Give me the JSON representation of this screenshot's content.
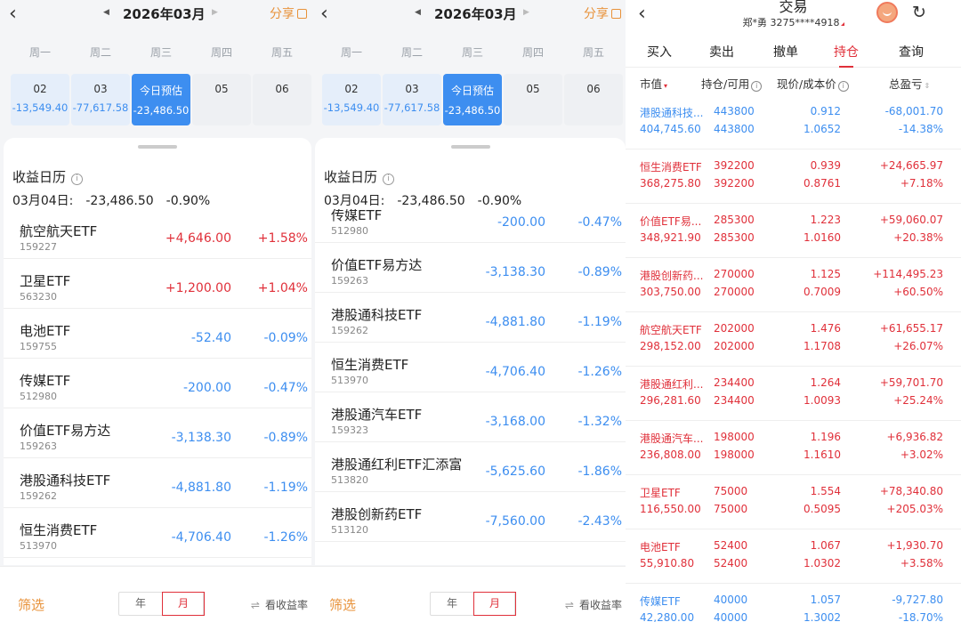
{
  "calendar": {
    "back_icon": "chevron-left-icon",
    "month": "2026年03月",
    "share_label": "分享",
    "weekdays": [
      "周一",
      "周二",
      "周三",
      "周四",
      "周五"
    ],
    "days": [
      {
        "day": "02",
        "value": "-13,549.40"
      },
      {
        "day": "03",
        "value": "-77,617.58"
      },
      {
        "day": "今日预估",
        "value": "-23,486.50"
      },
      {
        "day": "05",
        "value": ""
      },
      {
        "day": "06",
        "value": ""
      }
    ],
    "section_title": "收益日历",
    "summary": {
      "date": "03月04日:",
      "amount": "-23,486.50",
      "percent": "-0.90%"
    },
    "filter_label": "筛选",
    "seg_year": "年",
    "seg_month": "月",
    "yield_label": "看收益率"
  },
  "list_left": [
    {
      "name": "航空航天ETF",
      "code": "159227",
      "amount": "+4,646.00",
      "percent": "+1.58%",
      "up": true
    },
    {
      "name": "卫星ETF",
      "code": "563230",
      "amount": "+1,200.00",
      "percent": "+1.04%",
      "up": true
    },
    {
      "name": "电池ETF",
      "code": "159755",
      "amount": "-52.40",
      "percent": "-0.09%",
      "up": false
    },
    {
      "name": "传媒ETF",
      "code": "512980",
      "amount": "-200.00",
      "percent": "-0.47%",
      "up": false
    },
    {
      "name": "价值ETF易方达",
      "code": "159263",
      "amount": "-3,138.30",
      "percent": "-0.89%",
      "up": false
    },
    {
      "name": "港股通科技ETF",
      "code": "159262",
      "amount": "-4,881.80",
      "percent": "-1.19%",
      "up": false
    },
    {
      "name": "恒生消费ETF",
      "code": "513970",
      "amount": "-4,706.40",
      "percent": "-1.26%",
      "up": false
    }
  ],
  "list_right": [
    {
      "name": "传媒ETF",
      "code": "512980",
      "amount": "-200.00",
      "percent": "-0.47%",
      "up": false
    },
    {
      "name": "价值ETF易方达",
      "code": "159263",
      "amount": "-3,138.30",
      "percent": "-0.89%",
      "up": false
    },
    {
      "name": "港股通科技ETF",
      "code": "159262",
      "amount": "-4,881.80",
      "percent": "-1.19%",
      "up": false
    },
    {
      "name": "恒生消费ETF",
      "code": "513970",
      "amount": "-4,706.40",
      "percent": "-1.26%",
      "up": false
    },
    {
      "name": "港股通汽车ETF",
      "code": "159323",
      "amount": "-3,168.00",
      "percent": "-1.32%",
      "up": false
    },
    {
      "name": "港股通红利ETF汇添富",
      "code": "513820",
      "amount": "-5,625.60",
      "percent": "-1.86%",
      "up": false
    },
    {
      "name": "港股创新药ETF",
      "code": "513120",
      "amount": "-7,560.00",
      "percent": "-2.43%",
      "up": false
    }
  ],
  "trade": {
    "title": "交易",
    "account": "郑*勇 3275****4918",
    "tabs": [
      "买入",
      "卖出",
      "撤单",
      "持仓",
      "查询"
    ],
    "active_tab": 3,
    "columns": [
      "市值",
      "持仓/可用",
      "现价/成本价",
      "总盈亏"
    ],
    "holdings": [
      {
        "name": "港股通科技...",
        "value": "404,745.60",
        "hold": "443800",
        "avail": "443800",
        "price": "0.912",
        "cost": "1.0652",
        "pnl": "-68,001.70",
        "pnl_pct": "-14.38%",
        "up": false
      },
      {
        "name": "恒生消费ETF",
        "value": "368,275.80",
        "hold": "392200",
        "avail": "392200",
        "price": "0.939",
        "cost": "0.8761",
        "pnl": "+24,665.97",
        "pnl_pct": "+7.18%",
        "up": true
      },
      {
        "name": "价值ETF易...",
        "value": "348,921.90",
        "hold": "285300",
        "avail": "285300",
        "price": "1.223",
        "cost": "1.0160",
        "pnl": "+59,060.07",
        "pnl_pct": "+20.38%",
        "up": true
      },
      {
        "name": "港股创新药...",
        "value": "303,750.00",
        "hold": "270000",
        "avail": "270000",
        "price": "1.125",
        "cost": "0.7009",
        "pnl": "+114,495.23",
        "pnl_pct": "+60.50%",
        "up": true
      },
      {
        "name": "航空航天ETF",
        "value": "298,152.00",
        "hold": "202000",
        "avail": "202000",
        "price": "1.476",
        "cost": "1.1708",
        "pnl": "+61,655.17",
        "pnl_pct": "+26.07%",
        "up": true
      },
      {
        "name": "港股通红利...",
        "value": "296,281.60",
        "hold": "234400",
        "avail": "234400",
        "price": "1.264",
        "cost": "1.0093",
        "pnl": "+59,701.70",
        "pnl_pct": "+25.24%",
        "up": true
      },
      {
        "name": "港股通汽车...",
        "value": "236,808.00",
        "hold": "198000",
        "avail": "198000",
        "price": "1.196",
        "cost": "1.1610",
        "pnl": "+6,936.82",
        "pnl_pct": "+3.02%",
        "up": true
      },
      {
        "name": "卫星ETF",
        "value": "116,550.00",
        "hold": "75000",
        "avail": "75000",
        "price": "1.554",
        "cost": "0.5095",
        "pnl": "+78,340.80",
        "pnl_pct": "+205.03%",
        "up": true
      },
      {
        "name": "电池ETF",
        "value": "55,910.80",
        "hold": "52400",
        "avail": "52400",
        "price": "1.067",
        "cost": "1.0302",
        "pnl": "+1,930.70",
        "pnl_pct": "+3.58%",
        "up": true
      },
      {
        "name": "传媒ETF",
        "value": "42,280.00",
        "hold": "40000",
        "avail": "40000",
        "price": "1.057",
        "cost": "1.3002",
        "pnl": "-9,727.80",
        "pnl_pct": "-18.70%",
        "up": false
      }
    ]
  },
  "colors": {
    "up": "#e0303a",
    "down": "#3d8ef0",
    "accent": "#e8923a",
    "today_bg": "#3d8ef0"
  }
}
